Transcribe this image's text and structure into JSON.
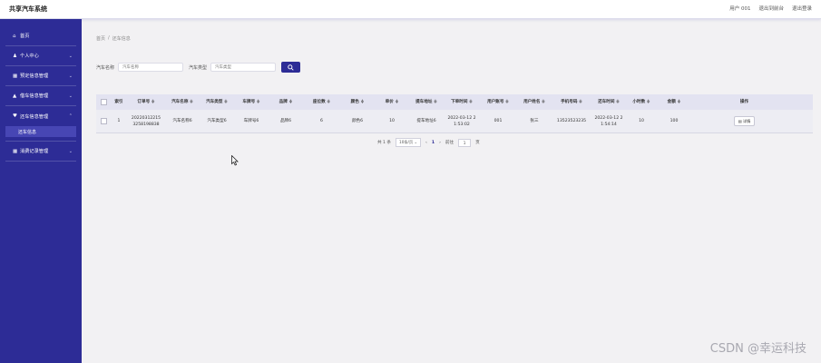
{
  "app": {
    "title": "共享汽车系统"
  },
  "header": {
    "user": "用户 001",
    "back_home": "退出到前台",
    "logout": "退出登录"
  },
  "sidebar": {
    "items": [
      {
        "icon": "home-icon",
        "glyph": "⌂",
        "label": "首页",
        "has_chevron": false
      },
      {
        "icon": "user-icon",
        "glyph": "♟",
        "label": "个人中心",
        "has_chevron": true
      },
      {
        "icon": "grid-icon",
        "glyph": "▦",
        "label": "预定信息管理",
        "has_chevron": true
      },
      {
        "icon": "car-icon",
        "glyph": "▲",
        "label": "借车信息管理",
        "has_chevron": true
      },
      {
        "icon": "return-icon",
        "glyph": "♥",
        "label": "还车信息管理",
        "has_chevron": true
      },
      {
        "icon": "grid-icon",
        "glyph": "▦",
        "label": "消费记录管理",
        "has_chevron": true
      }
    ],
    "submenu_label": "还车信息"
  },
  "breadcrumb": {
    "home": "首页",
    "sep": "/",
    "current": "还车信息"
  },
  "search": {
    "car_name_label": "汽车名称",
    "car_name_placeholder": "汽车名称",
    "car_type_label": "汽车类型",
    "car_type_placeholder": "汽车类型",
    "button_icon": "search-icon"
  },
  "table": {
    "columns": [
      "",
      "索引",
      "订单号 ≑",
      "汽车名称 ≑",
      "汽车类型 ≑",
      "车牌号 ≑",
      "品牌 ≑",
      "座位数 ≑",
      "颜色 ≑",
      "单价 ≑",
      "提车地址 ≑",
      "下单时间 ≑",
      "用户账号 ≑",
      "用户姓名 ≑",
      "手机号码 ≑",
      "还车时间 ≑",
      "小时数 ≑",
      "金额 ≑",
      "操作"
    ],
    "rows": [
      {
        "index": "1",
        "order_no": "20220312215 3258198838",
        "car_name": "汽车名称6",
        "car_type": "汽车类型6",
        "plate": "车牌号6",
        "brand": "品牌6",
        "seats": "6",
        "color": "颜色6",
        "price": "10",
        "pickup": "提车地址6",
        "order_time": "2022-03-12 2 1:53:02",
        "account": "001",
        "name": "张三",
        "phone": "13523523235",
        "return_time": "2022-03-12 2 1:54:14",
        "hours": "10",
        "amount": "100",
        "action": "详情"
      }
    ]
  },
  "pagination": {
    "total": "共 1 条",
    "page_size": "10条/页",
    "prev": "‹",
    "current": "1",
    "next": "›",
    "goto_prefix": "前往",
    "goto_value": "1",
    "goto_suffix": "页"
  },
  "watermark": "CSDN @幸运科技",
  "colors": {
    "sidebar": "#2d2c96",
    "accent": "#2d2c96",
    "background": "#f2f1f3"
  }
}
